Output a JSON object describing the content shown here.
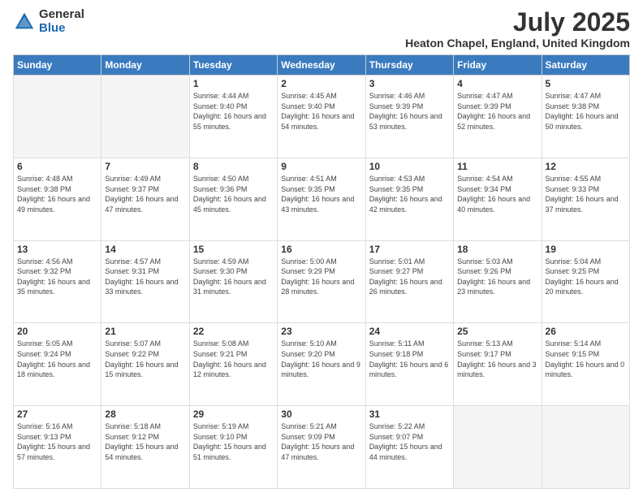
{
  "logo": {
    "general": "General",
    "blue": "Blue"
  },
  "title": "July 2025",
  "subtitle": "Heaton Chapel, England, United Kingdom",
  "days_of_week": [
    "Sunday",
    "Monday",
    "Tuesday",
    "Wednesday",
    "Thursday",
    "Friday",
    "Saturday"
  ],
  "weeks": [
    [
      {
        "day": "",
        "info": ""
      },
      {
        "day": "",
        "info": ""
      },
      {
        "day": "1",
        "info": "Sunrise: 4:44 AM\nSunset: 9:40 PM\nDaylight: 16 hours and 55 minutes."
      },
      {
        "day": "2",
        "info": "Sunrise: 4:45 AM\nSunset: 9:40 PM\nDaylight: 16 hours and 54 minutes."
      },
      {
        "day": "3",
        "info": "Sunrise: 4:46 AM\nSunset: 9:39 PM\nDaylight: 16 hours and 53 minutes."
      },
      {
        "day": "4",
        "info": "Sunrise: 4:47 AM\nSunset: 9:39 PM\nDaylight: 16 hours and 52 minutes."
      },
      {
        "day": "5",
        "info": "Sunrise: 4:47 AM\nSunset: 9:38 PM\nDaylight: 16 hours and 50 minutes."
      }
    ],
    [
      {
        "day": "6",
        "info": "Sunrise: 4:48 AM\nSunset: 9:38 PM\nDaylight: 16 hours and 49 minutes."
      },
      {
        "day": "7",
        "info": "Sunrise: 4:49 AM\nSunset: 9:37 PM\nDaylight: 16 hours and 47 minutes."
      },
      {
        "day": "8",
        "info": "Sunrise: 4:50 AM\nSunset: 9:36 PM\nDaylight: 16 hours and 45 minutes."
      },
      {
        "day": "9",
        "info": "Sunrise: 4:51 AM\nSunset: 9:35 PM\nDaylight: 16 hours and 43 minutes."
      },
      {
        "day": "10",
        "info": "Sunrise: 4:53 AM\nSunset: 9:35 PM\nDaylight: 16 hours and 42 minutes."
      },
      {
        "day": "11",
        "info": "Sunrise: 4:54 AM\nSunset: 9:34 PM\nDaylight: 16 hours and 40 minutes."
      },
      {
        "day": "12",
        "info": "Sunrise: 4:55 AM\nSunset: 9:33 PM\nDaylight: 16 hours and 37 minutes."
      }
    ],
    [
      {
        "day": "13",
        "info": "Sunrise: 4:56 AM\nSunset: 9:32 PM\nDaylight: 16 hours and 35 minutes."
      },
      {
        "day": "14",
        "info": "Sunrise: 4:57 AM\nSunset: 9:31 PM\nDaylight: 16 hours and 33 minutes."
      },
      {
        "day": "15",
        "info": "Sunrise: 4:59 AM\nSunset: 9:30 PM\nDaylight: 16 hours and 31 minutes."
      },
      {
        "day": "16",
        "info": "Sunrise: 5:00 AM\nSunset: 9:29 PM\nDaylight: 16 hours and 28 minutes."
      },
      {
        "day": "17",
        "info": "Sunrise: 5:01 AM\nSunset: 9:27 PM\nDaylight: 16 hours and 26 minutes."
      },
      {
        "day": "18",
        "info": "Sunrise: 5:03 AM\nSunset: 9:26 PM\nDaylight: 16 hours and 23 minutes."
      },
      {
        "day": "19",
        "info": "Sunrise: 5:04 AM\nSunset: 9:25 PM\nDaylight: 16 hours and 20 minutes."
      }
    ],
    [
      {
        "day": "20",
        "info": "Sunrise: 5:05 AM\nSunset: 9:24 PM\nDaylight: 16 hours and 18 minutes."
      },
      {
        "day": "21",
        "info": "Sunrise: 5:07 AM\nSunset: 9:22 PM\nDaylight: 16 hours and 15 minutes."
      },
      {
        "day": "22",
        "info": "Sunrise: 5:08 AM\nSunset: 9:21 PM\nDaylight: 16 hours and 12 minutes."
      },
      {
        "day": "23",
        "info": "Sunrise: 5:10 AM\nSunset: 9:20 PM\nDaylight: 16 hours and 9 minutes."
      },
      {
        "day": "24",
        "info": "Sunrise: 5:11 AM\nSunset: 9:18 PM\nDaylight: 16 hours and 6 minutes."
      },
      {
        "day": "25",
        "info": "Sunrise: 5:13 AM\nSunset: 9:17 PM\nDaylight: 16 hours and 3 minutes."
      },
      {
        "day": "26",
        "info": "Sunrise: 5:14 AM\nSunset: 9:15 PM\nDaylight: 16 hours and 0 minutes."
      }
    ],
    [
      {
        "day": "27",
        "info": "Sunrise: 5:16 AM\nSunset: 9:13 PM\nDaylight: 15 hours and 57 minutes."
      },
      {
        "day": "28",
        "info": "Sunrise: 5:18 AM\nSunset: 9:12 PM\nDaylight: 15 hours and 54 minutes."
      },
      {
        "day": "29",
        "info": "Sunrise: 5:19 AM\nSunset: 9:10 PM\nDaylight: 15 hours and 51 minutes."
      },
      {
        "day": "30",
        "info": "Sunrise: 5:21 AM\nSunset: 9:09 PM\nDaylight: 15 hours and 47 minutes."
      },
      {
        "day": "31",
        "info": "Sunrise: 5:22 AM\nSunset: 9:07 PM\nDaylight: 15 hours and 44 minutes."
      },
      {
        "day": "",
        "info": ""
      },
      {
        "day": "",
        "info": ""
      }
    ]
  ]
}
